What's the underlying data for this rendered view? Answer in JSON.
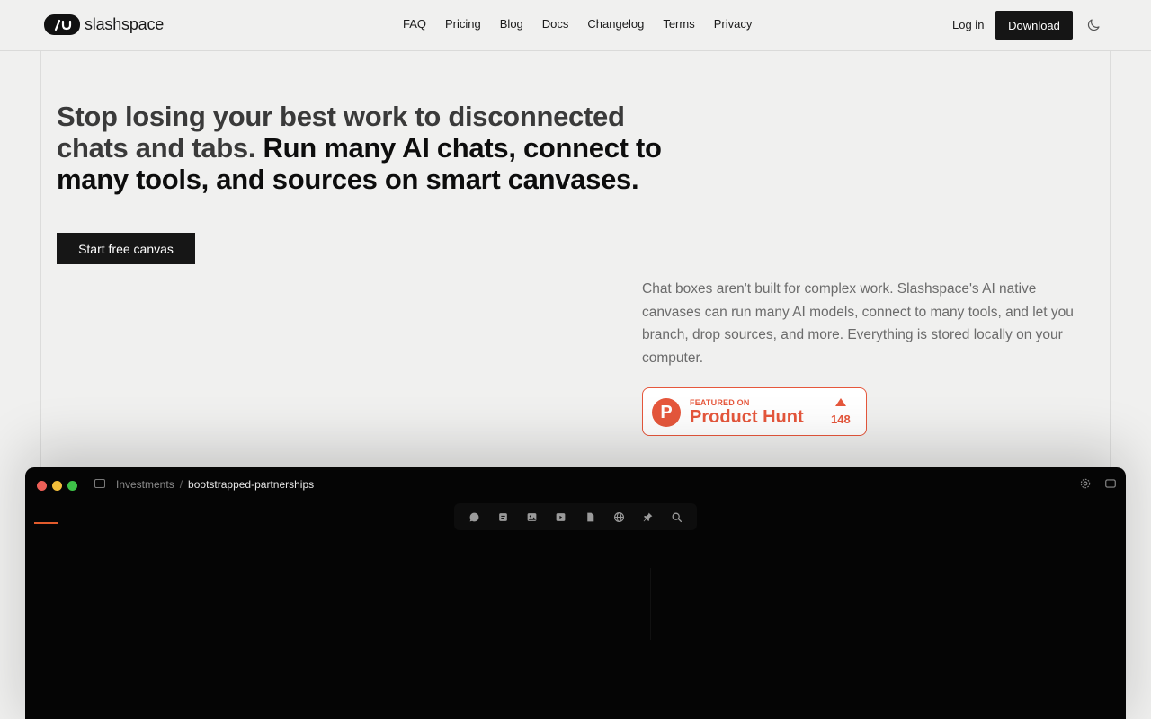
{
  "header": {
    "logo_text": "slashspace",
    "logo_mark": "/∪",
    "nav": [
      "FAQ",
      "Pricing",
      "Blog",
      "Docs",
      "Changelog",
      "Terms",
      "Privacy"
    ],
    "login_label": "Log in",
    "download_label": "Download",
    "theme_icon": "moon-icon"
  },
  "hero": {
    "headline_muted": "Stop losing your best work to disconnected chats and tabs.",
    "headline_strong": "Run many AI chats, connect to many tools, and sources on smart canvases.",
    "cta_label": "Start free canvas",
    "description": "Chat boxes aren't built for complex work. Slashspace's AI native canvases can run many AI models, connect to many tools, and let you branch, drop sources, and more. Everything is stored locally on your computer.",
    "product_hunt": {
      "small_label": "FEATURED ON",
      "big_label": "Product Hunt",
      "logo_letter": "P",
      "count": "148"
    }
  },
  "app": {
    "breadcrumb": {
      "parent": "Investments",
      "separator": "/",
      "current": "bootstrapped-partnerships"
    },
    "toolbar_icons": [
      "chat-icon",
      "note-icon",
      "image-icon",
      "video-icon",
      "file-icon",
      "globe-icon",
      "pin-icon",
      "search-icon"
    ],
    "colors": {
      "accent": "#e25b2c",
      "window_bg": "#050505",
      "product_hunt": "#e6573c"
    }
  }
}
